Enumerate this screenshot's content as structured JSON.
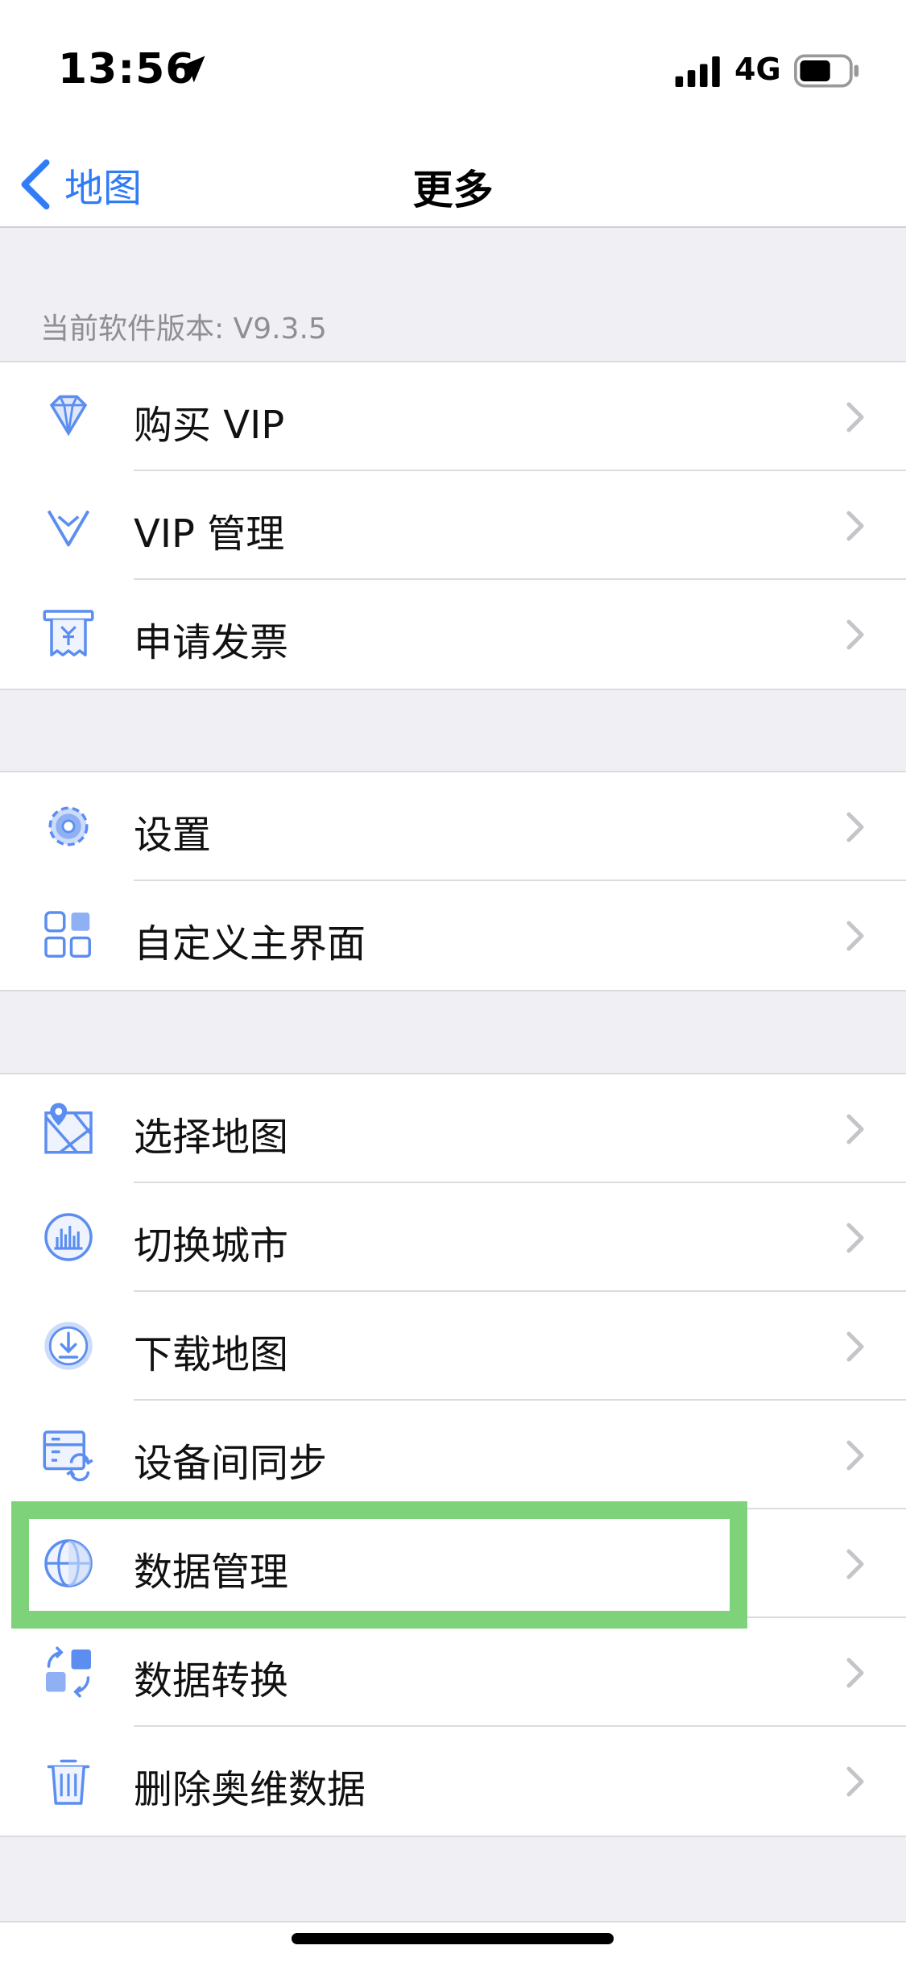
{
  "status_bar": {
    "time": "13:56",
    "network": "4G"
  },
  "nav": {
    "back_label": "地图",
    "title": "更多"
  },
  "version_label": "当前软件版本: V9.3.5",
  "groups": [
    [
      {
        "label": "购买 VIP",
        "icon": "diamond-icon"
      },
      {
        "label": "VIP 管理",
        "icon": "vip-badge-icon"
      },
      {
        "label": "申请发票",
        "icon": "invoice-icon"
      }
    ],
    [
      {
        "label": "设置",
        "icon": "gear-icon"
      },
      {
        "label": "自定义主界面",
        "icon": "grid-icon"
      }
    ],
    [
      {
        "label": "选择地图",
        "icon": "map-icon"
      },
      {
        "label": "切换城市",
        "icon": "city-icon"
      },
      {
        "label": "下载地图",
        "icon": "download-icon"
      },
      {
        "label": "设备间同步",
        "icon": "sync-icon"
      },
      {
        "label": "数据管理",
        "icon": "globe-icon"
      },
      {
        "label": "数据转换",
        "icon": "convert-icon"
      },
      {
        "label": "删除奥维数据",
        "icon": "trash-icon"
      }
    ]
  ],
  "colors": {
    "accent": "#2f7cf6",
    "icon_blue": "#5b8ef0",
    "highlight": "#7ed37a",
    "background": "#efeff4"
  }
}
